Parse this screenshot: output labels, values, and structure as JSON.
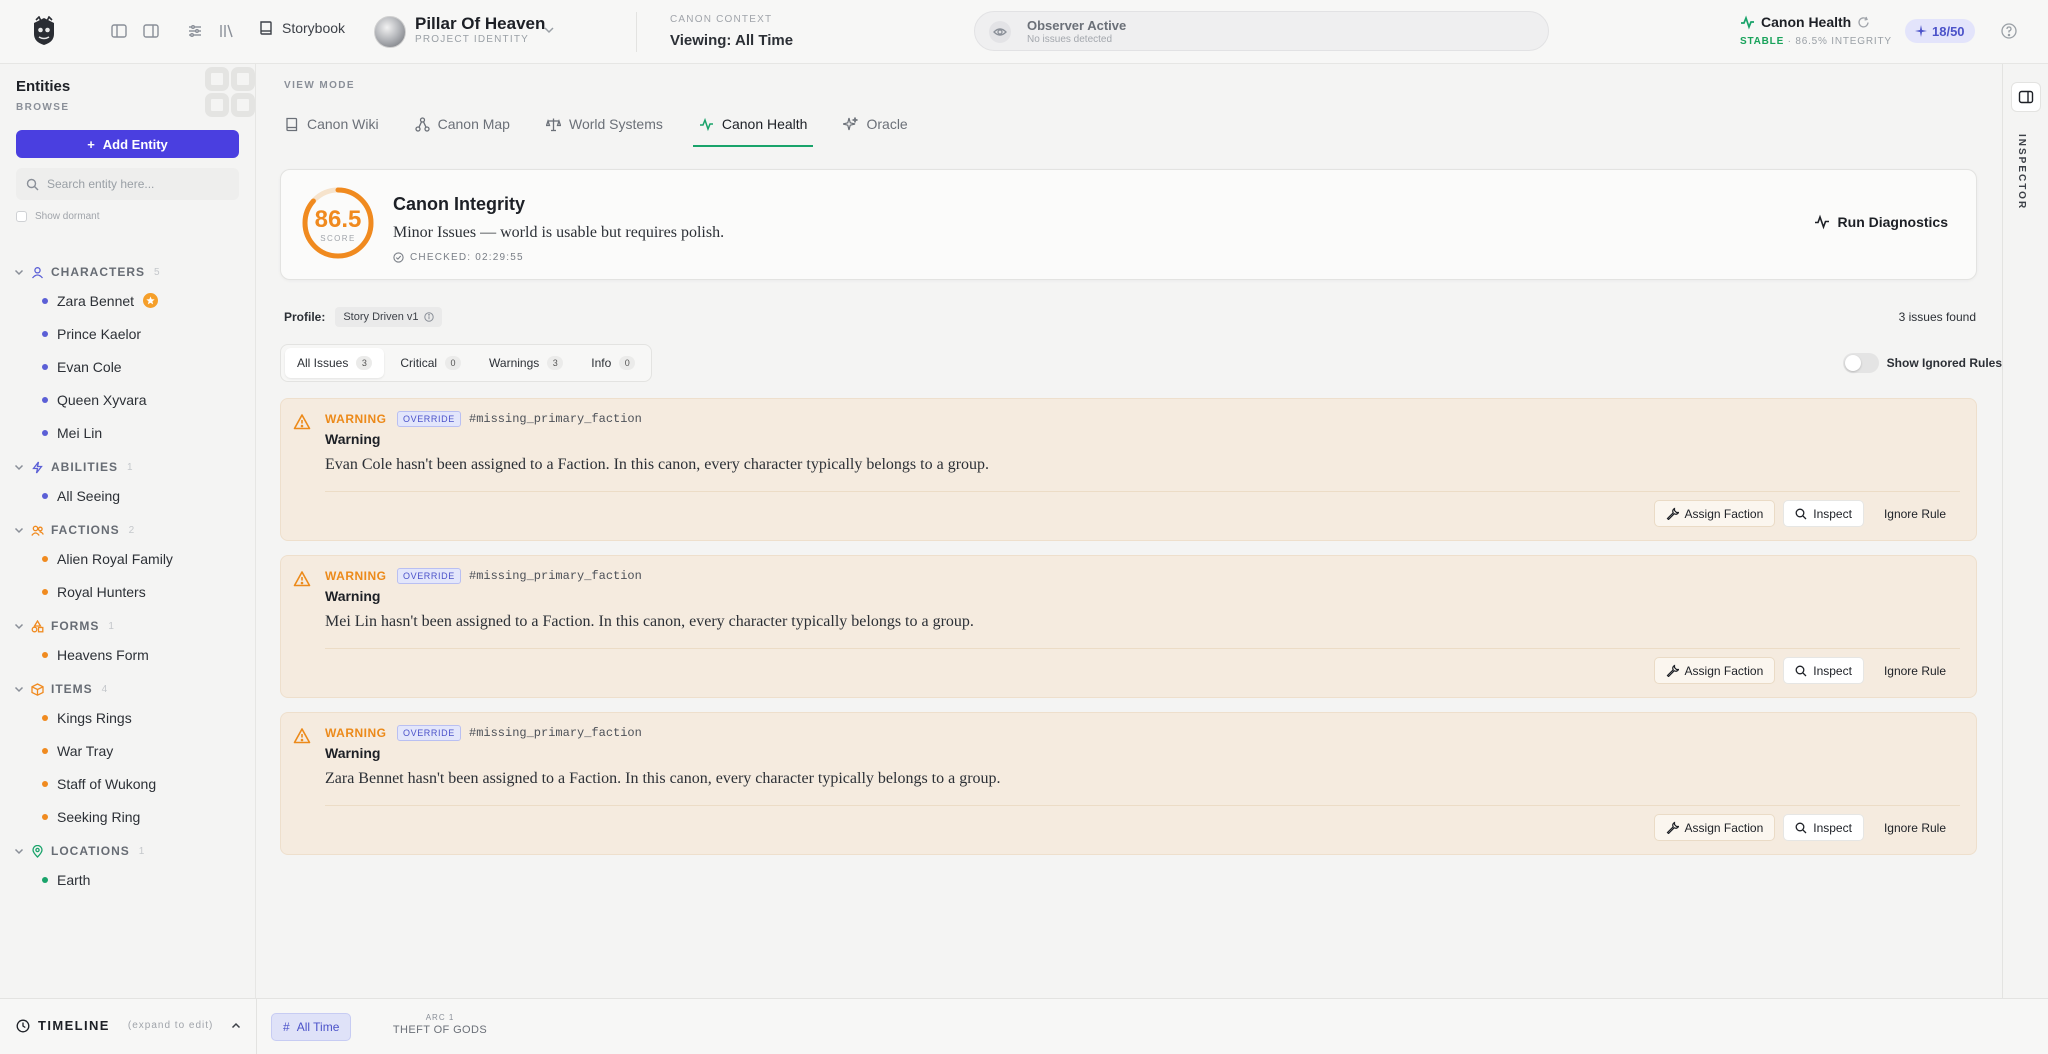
{
  "topbar": {
    "storybook_label": "Storybook",
    "project_name": "Pillar Of Heaven",
    "project_sub": "PROJECT IDENTITY",
    "canon_context_label": "CANON CONTEXT",
    "canon_context_value": "Viewing: All Time",
    "observer_title": "Observer Active",
    "observer_sub": "No issues detected",
    "health_title": "Canon Health",
    "health_status": "STABLE",
    "health_integrity": "· 86.5% INTEGRITY",
    "counter": "18/50"
  },
  "sidebar": {
    "title": "Entities",
    "browse_label": "BROWSE",
    "add_label": "Add Entity",
    "search_placeholder": "Search entity here...",
    "dormant_label": "Show dormant",
    "categories": [
      {
        "label": "CHARACTERS",
        "count": "5",
        "color": "#5b5fd6",
        "icon": "user-icon",
        "items": [
          "Zara Bennet",
          "Prince Kaelor",
          "Evan Cole",
          "Queen Xyvara",
          "Mei Lin"
        ]
      },
      {
        "label": "ABILITIES",
        "count": "1",
        "color": "#5b5fd6",
        "icon": "bolt-icon",
        "items": [
          "All Seeing"
        ]
      },
      {
        "label": "FACTIONS",
        "count": "2",
        "color": "#f08a1f",
        "icon": "users-icon",
        "items": [
          "Alien Royal Family",
          "Royal Hunters"
        ]
      },
      {
        "label": "FORMS",
        "count": "1",
        "color": "#f08a1f",
        "icon": "shapes-icon",
        "items": [
          "Heavens Form"
        ]
      },
      {
        "label": "ITEMS",
        "count": "4",
        "color": "#f08a1f",
        "icon": "box-icon",
        "items": [
          "Kings Rings",
          "War Tray",
          "Staff of Wukong",
          "Seeking Ring"
        ]
      },
      {
        "label": "LOCATIONS",
        "count": "1",
        "color": "#19a36a",
        "icon": "pin-icon",
        "items": [
          "Earth"
        ]
      }
    ]
  },
  "main": {
    "view_mode_label": "VIEW MODE",
    "tabs": [
      {
        "label": "Canon Wiki",
        "icon": "book-icon"
      },
      {
        "label": "Canon Map",
        "icon": "network-icon"
      },
      {
        "label": "World Systems",
        "icon": "scale-icon"
      },
      {
        "label": "Canon Health",
        "icon": "pulse-icon"
      },
      {
        "label": "Oracle",
        "icon": "sparkle-icon"
      }
    ],
    "active_tab": "Canon Health",
    "integrity": {
      "score": "86.5",
      "score_fraction": 0.865,
      "score_label": "SCORE",
      "title": "Canon Integrity",
      "description": "Minor Issues — world is usable but requires polish.",
      "checked": "CHECKED: 02:29:55",
      "run_label": "Run Diagnostics"
    },
    "profile_label": "Profile:",
    "profile_value": "Story Driven v1",
    "issues_found": "3 issues found",
    "filters": [
      {
        "label": "All Issues",
        "count": "3"
      },
      {
        "label": "Critical",
        "count": "0"
      },
      {
        "label": "Warnings",
        "count": "3"
      },
      {
        "label": "Info",
        "count": "0"
      }
    ],
    "show_ignored_label": "Show Ignored Rules",
    "issues": [
      {
        "severity": "WARNING",
        "override": "OVERRIDE",
        "rule": "#missing_primary_faction",
        "title": "Warning",
        "message": "Evan Cole hasn't been assigned to a Faction. In this canon, every character typically belongs to a group.",
        "assign": "Assign Faction",
        "inspect": "Inspect",
        "ignore": "Ignore Rule"
      },
      {
        "severity": "WARNING",
        "override": "OVERRIDE",
        "rule": "#missing_primary_faction",
        "title": "Warning",
        "message": "Mei Lin hasn't been assigned to a Faction. In this canon, every character typically belongs to a group.",
        "assign": "Assign Faction",
        "inspect": "Inspect",
        "ignore": "Ignore Rule"
      },
      {
        "severity": "WARNING",
        "override": "OVERRIDE",
        "rule": "#missing_primary_faction",
        "title": "Warning",
        "message": "Zara Bennet hasn't been assigned to a Faction. In this canon, every character typically belongs to a group.",
        "assign": "Assign Faction",
        "inspect": "Inspect",
        "ignore": "Ignore Rule"
      }
    ]
  },
  "inspector": {
    "label": "INSPECTOR"
  },
  "timeline": {
    "title": "TIMELINE",
    "hint": "(expand to edit)",
    "all_time": "All Time",
    "arc_label": "ARC 1",
    "arc_name": "THEFT OF GODS"
  },
  "colors": {
    "accent": "#4a3fe0",
    "health_green": "#19a36a",
    "warning_orange": "#ec8a1a",
    "warning_bg": "#f5ebdf"
  }
}
